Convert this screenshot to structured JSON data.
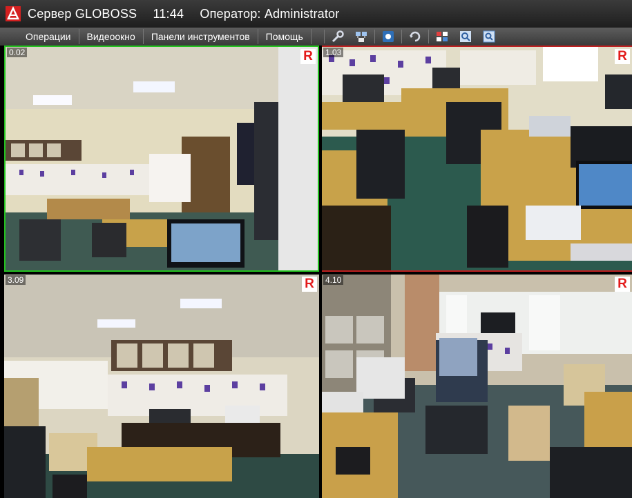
{
  "titlebar": {
    "server": "Сервер GLOBOSS",
    "time": "11:44",
    "operator": "Оператор: Administrator"
  },
  "menu": [
    {
      "label": "Операции"
    },
    {
      "label": "Видеоокно"
    },
    {
      "label": "Панели инструментов"
    },
    {
      "label": "Помощь"
    }
  ],
  "toolbar": {
    "icons": [
      "wrench-icon",
      "network-icon",
      "camera-settings-icon",
      "rotate-icon",
      "layout-grid-icon",
      "zoom-icon",
      "zoom-window-icon"
    ]
  },
  "cameras": [
    {
      "id": "0.02",
      "rec": "R",
      "active": true
    },
    {
      "id": "1.03",
      "rec": "R",
      "active": false
    },
    {
      "id": "3.09",
      "rec": "R",
      "active": false
    },
    {
      "id": "4.10",
      "rec": "R",
      "active": false
    }
  ],
  "colors": {
    "active_border": "#24c21f",
    "alarm_border": "#c02020",
    "rec_badge": "#e31b1b"
  }
}
